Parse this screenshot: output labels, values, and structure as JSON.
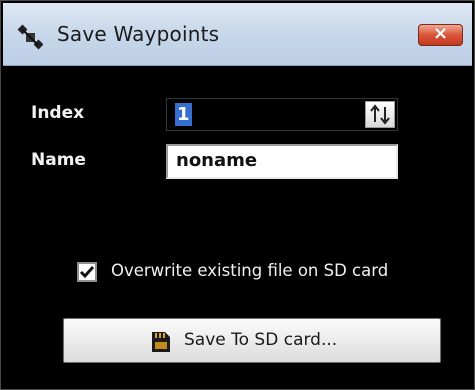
{
  "window": {
    "title": "Save Waypoints",
    "icon": "satellite-icon",
    "close_icon": "close-icon",
    "close_color": "#d9553a"
  },
  "form": {
    "index_label": "Index",
    "index_value": "1",
    "index_spinner_icon": "up-down-arrows-icon",
    "name_label": "Name",
    "name_value": "noname"
  },
  "options": {
    "overwrite_label": "Overwrite existing file on SD card",
    "overwrite_checked": true
  },
  "actions": {
    "save_label": "Save To SD card...",
    "save_icon": "sd-card-icon"
  }
}
